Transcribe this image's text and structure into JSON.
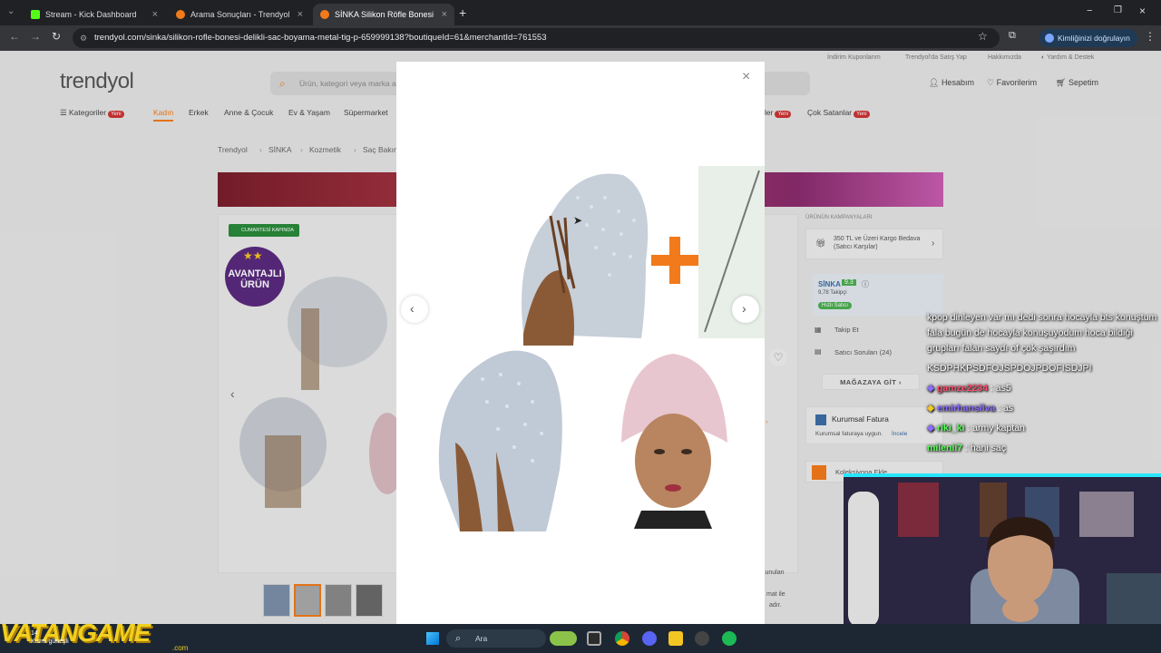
{
  "browser": {
    "tabs": [
      {
        "title": "Stream - Kick Dashboard",
        "favicon_color": "#53fc18"
      },
      {
        "title": "Arama Sonuçları - Trendyol",
        "favicon_color": "#f27a1a"
      },
      {
        "title": "SİNKA Silikon Röfle Bonesi Deli",
        "favicon_color": "#f27a1a"
      }
    ],
    "url": "trendyol.com/sinka/silikon-rofle-bonesi-delikli-sac-boyama-metal-tig-p-659999138?boutiqueId=61&merchantId=761553",
    "profile_label": "Kimliğinizi doğrulayın"
  },
  "site": {
    "top_links": [
      "İndirim Kuponlarım",
      "Trendyol'da Satış Yap",
      "Hakkımızda",
      "Yardım & Destek"
    ],
    "logo": "trendyol",
    "search_placeholder": "Ürün, kategori veya marka a",
    "header_actions": [
      "Hesabım",
      "Favorilerim",
      "Sepetim"
    ],
    "categories_label": "Kategoriler",
    "new_badge": "Yeni",
    "nav": [
      "Kadın",
      "Erkek",
      "Anne & Çocuk",
      "Ev & Yaşam",
      "Süpermarket"
    ],
    "nav_right": [
      "ler",
      "Çok Satanlar"
    ],
    "breadcrumb": [
      "Trendyol",
      "SİNKA",
      "Kozmetik",
      "Saç Bakım"
    ],
    "cargo_badge": "CUMARTESİ KAPINDA",
    "avantaj_badge": "AVANTAJLI ÜRÜN",
    "campaigns_title": "ÜRÜNÜN KAMPANYALARI",
    "campaign": "350 TL ve Üzeri Kargo Bedava (Satıcı Karşılar)",
    "seller": {
      "name": "SİNKA",
      "score": "9.3",
      "followers": "9,78 Takipçi",
      "badge": "Hızlı Satıcı",
      "follow": "Takip Et",
      "questions": "Satıcı Soruları (24)",
      "store_button": "MAĞAZAYA GİT"
    },
    "corporate": {
      "title": "Kurumsal Fatura",
      "desc": "Kurumsal faturaya uygun.",
      "link": "İncele"
    },
    "collection": "Koleksiyona Ekle",
    "misc_right": [
      "sunulan",
      "mat ile",
      "adır."
    ]
  },
  "modal": {
    "close_icon": "close-icon",
    "prev_icon": "chevron-left-icon",
    "next_icon": "chevron-right-icon"
  },
  "chat": {
    "messages": [
      {
        "user": "",
        "text": "kpop dinleyen var mı dedi sonra hocayla bts konuştum fala bugün de hocayla konuşuyodum hoca bildiği grupları falan saydı of çok şaşırdım"
      },
      {
        "user": "",
        "text": "KSDPHKPSDFOJSPDOJPDOFISDJPI"
      },
      {
        "user": "gamze2234",
        "text": ": as5",
        "color": "#ff4d6d"
      },
      {
        "user": "emirhansilva",
        "text": ": as",
        "color": "#8a6cff"
      },
      {
        "user": "riki_ki",
        "text": ": army kaptan",
        "color": "#5cff5c"
      },
      {
        "user": "milenii7",
        "text": ": hani saç",
        "color": "#5cff5c"
      }
    ]
  },
  "taskbar": {
    "search_label": "Ara",
    "watermark": "VATANGAME",
    "watermark_sub": ".com",
    "clock_top": "14",
    "clock_bottom": "Kısmi güneşli"
  }
}
